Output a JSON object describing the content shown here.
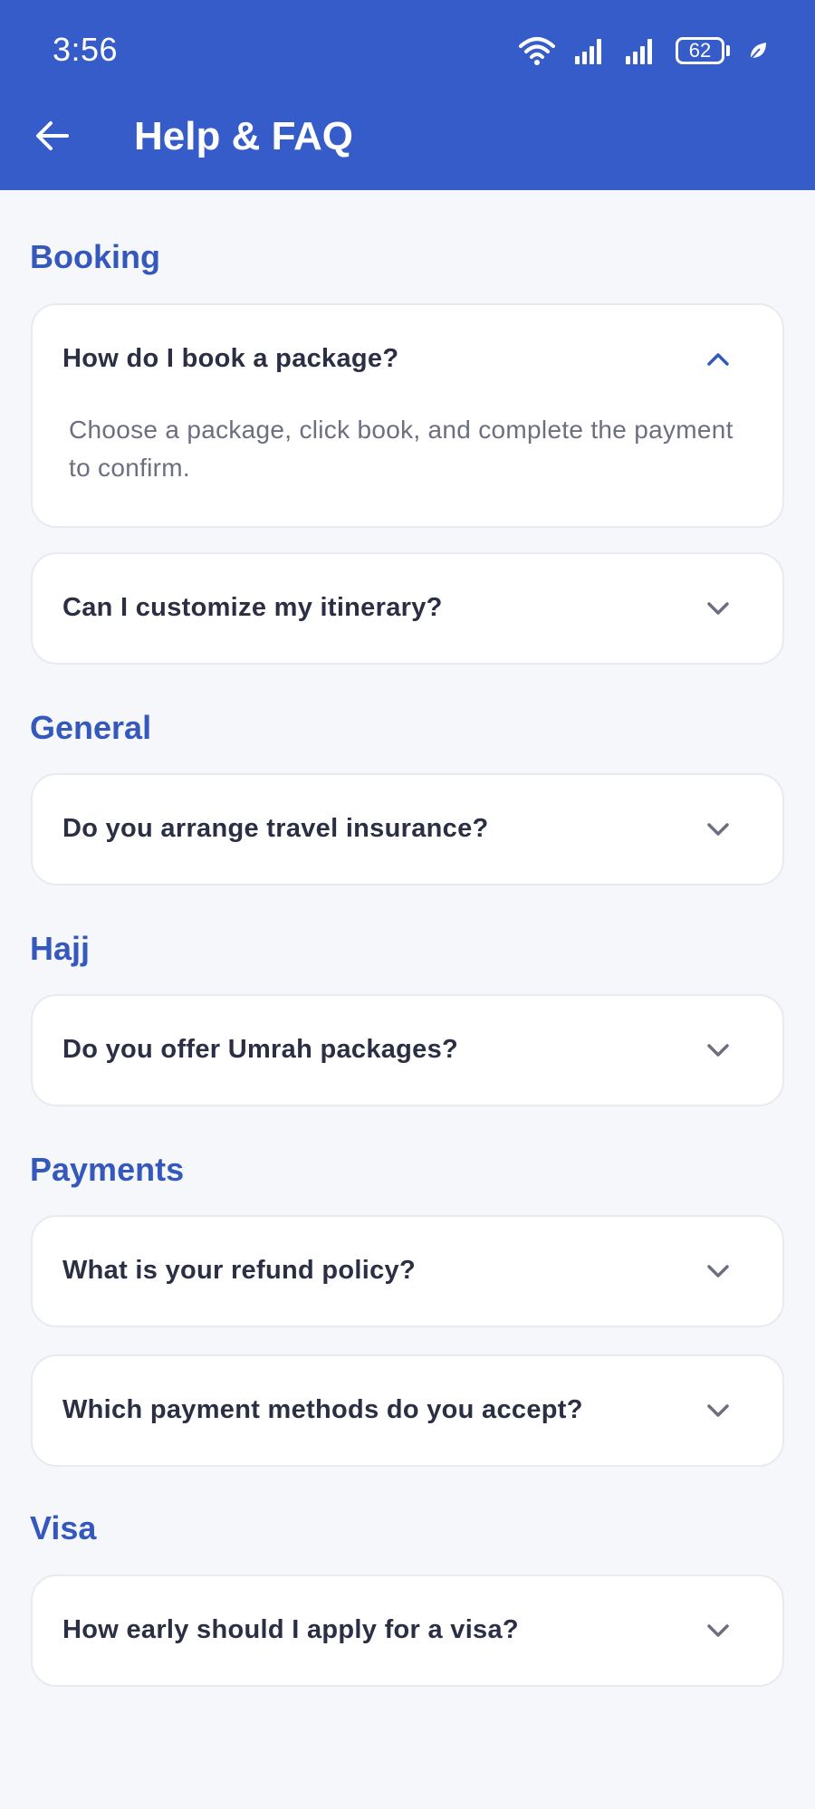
{
  "status_bar": {
    "time": "3:56",
    "battery": "62",
    "icons": [
      "wifi-icon",
      "signal-icon",
      "signal-icon",
      "battery-icon",
      "leaf-icon"
    ]
  },
  "header": {
    "back_icon": "arrow-left-icon",
    "title": "Help & FAQ"
  },
  "colors": {
    "header_bg": "#355cc9",
    "section_title": "#3558bd",
    "question_text": "#2b2f44",
    "answer_text": "#6b6f80",
    "page_bg": "#f6f7fb"
  },
  "sections": [
    {
      "title": "Booking",
      "items": [
        {
          "question": "How do I book a package?",
          "expanded": true,
          "answer": "Choose a package, click book, and complete the payment to confirm."
        },
        {
          "question": "Can I customize my itinerary?",
          "expanded": false
        }
      ]
    },
    {
      "title": "General",
      "items": [
        {
          "question": "Do you arrange travel insurance?",
          "expanded": false
        }
      ]
    },
    {
      "title": "Hajj",
      "items": [
        {
          "question": "Do you offer Umrah packages?",
          "expanded": false
        }
      ]
    },
    {
      "title": "Payments",
      "items": [
        {
          "question": "What is your refund policy?",
          "expanded": false
        },
        {
          "question": "Which payment methods do you accept?",
          "expanded": false
        }
      ]
    },
    {
      "title": "Visa",
      "items": [
        {
          "question": "How early should I apply for a visa?",
          "expanded": false
        }
      ]
    }
  ]
}
